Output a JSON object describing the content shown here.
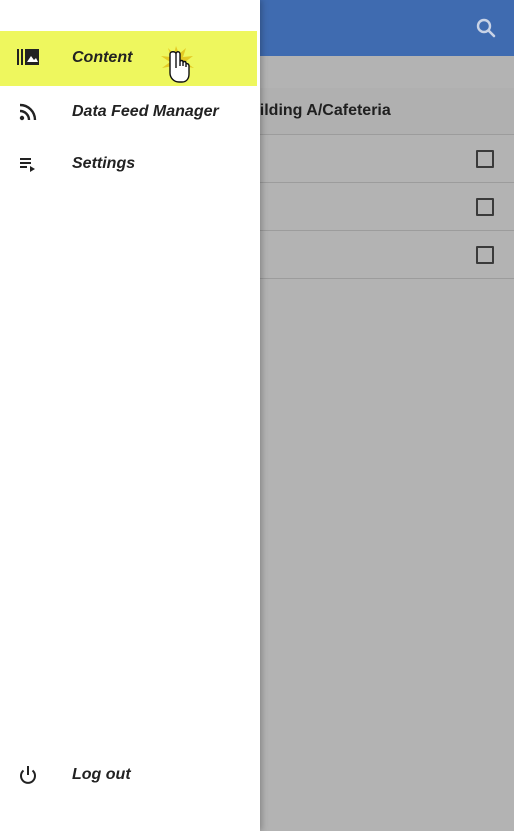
{
  "background": {
    "search_icon": "search-icon",
    "path_label": "uilding A/Cafeteria",
    "rows": [
      {
        "checked": false
      },
      {
        "checked": false
      },
      {
        "checked": false
      }
    ]
  },
  "drawer": {
    "items": [
      {
        "label": "Content",
        "icon": "media-library-icon",
        "active": true
      },
      {
        "label": "Data Feed Manager",
        "icon": "rss-feed-icon",
        "active": false
      },
      {
        "label": "Settings",
        "icon": "playlist-play-icon",
        "active": false
      }
    ],
    "logout": {
      "label": "Log out",
      "icon": "power-icon"
    }
  },
  "colors": {
    "appbar": "#3f6bb0",
    "active_highlight": "#eef75e",
    "scrim": "#b3b3b3"
  }
}
